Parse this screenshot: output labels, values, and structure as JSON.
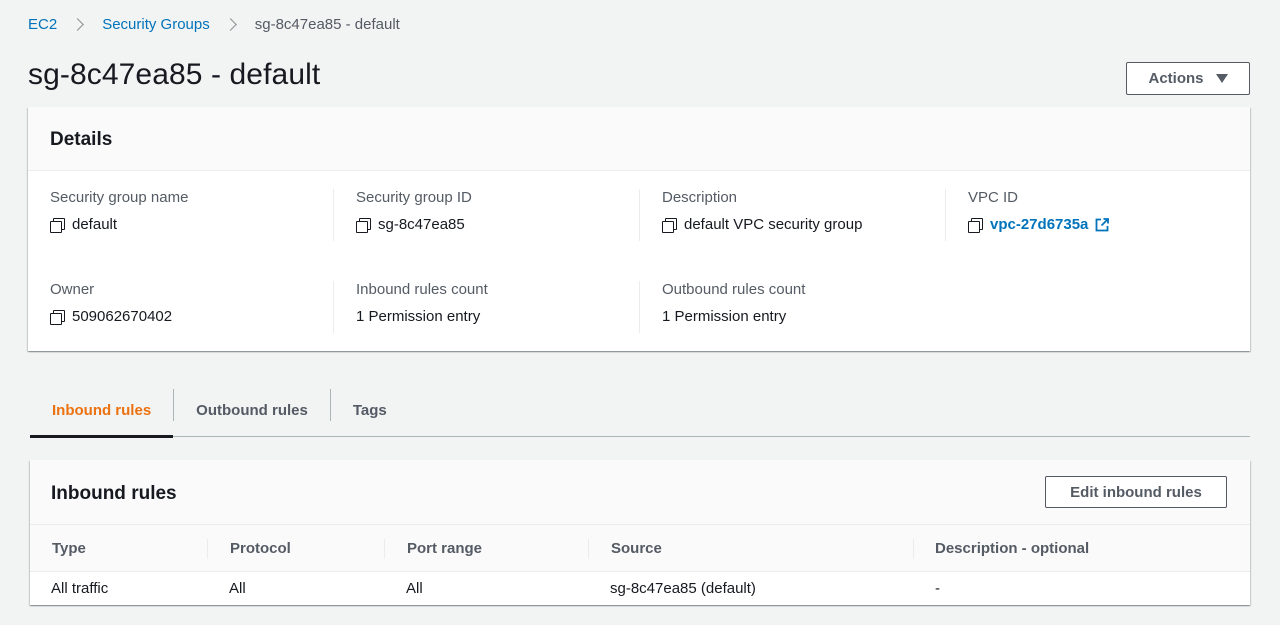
{
  "breadcrumb": {
    "items": [
      {
        "label": "EC2"
      },
      {
        "label": "Security Groups"
      },
      {
        "label": "sg-8c47ea85 - default"
      }
    ]
  },
  "page": {
    "title": "sg-8c47ea85 - default",
    "actions_label": "Actions"
  },
  "details": {
    "header": "Details",
    "fields": [
      {
        "label": "Security group name",
        "value": "default"
      },
      {
        "label": "Security group ID",
        "value": "sg-8c47ea85"
      },
      {
        "label": "Description",
        "value": "default VPC security group"
      },
      {
        "label": "VPC ID",
        "value": "vpc-27d6735a"
      },
      {
        "label": "Owner",
        "value": "509062670402"
      },
      {
        "label": "Inbound rules count",
        "value": "1 Permission entry"
      },
      {
        "label": "Outbound rules count",
        "value": "1 Permission entry"
      }
    ]
  },
  "tabs": [
    {
      "label": "Inbound rules",
      "active": true
    },
    {
      "label": "Outbound rules",
      "active": false
    },
    {
      "label": "Tags",
      "active": false
    }
  ],
  "inbound": {
    "header": "Inbound rules",
    "edit_label": "Edit inbound rules",
    "columns": [
      "Type",
      "Protocol",
      "Port range",
      "Source",
      "Description - optional"
    ],
    "rows": [
      [
        "All traffic",
        "All",
        "All",
        "sg-8c47ea85 (default)",
        "-"
      ]
    ]
  },
  "colors": {
    "link": "#0073bb",
    "active_tab": "#ec7211",
    "background": "#f2f3f3"
  },
  "icons": {
    "breadcrumb_separator": "chevron-right-icon",
    "copy": "copy-icon",
    "external": "external-link-icon",
    "dropdown": "caret-down-icon"
  }
}
